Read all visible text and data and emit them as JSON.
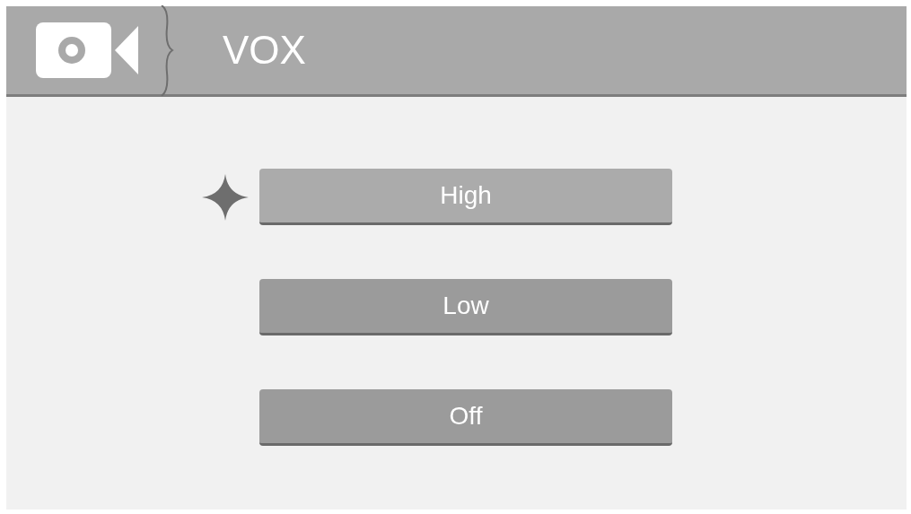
{
  "header": {
    "title": "VOX"
  },
  "options": [
    {
      "label": "High",
      "selected": true
    },
    {
      "label": "Low",
      "selected": false
    },
    {
      "label": "Off",
      "selected": false
    }
  ]
}
